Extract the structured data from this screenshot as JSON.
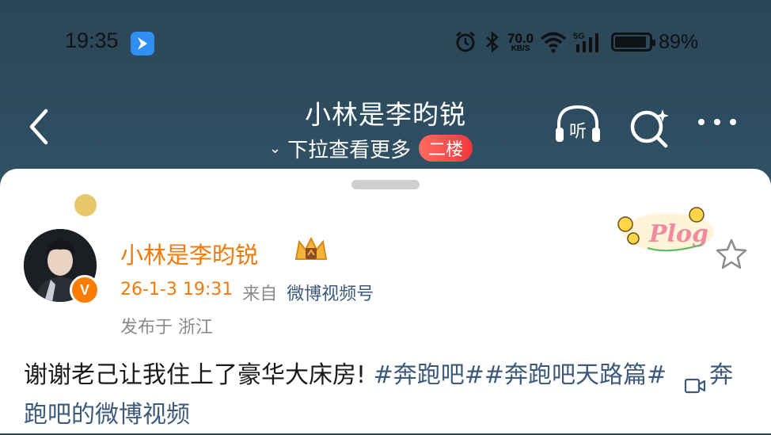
{
  "status_bar": {
    "time": "19:35",
    "net_speed_value": "70.0",
    "net_speed_unit": "KB/S",
    "signal_label": "5G",
    "battery_percent": "89%",
    "battery_level": 0.89
  },
  "nav": {
    "title": "小林是李昀锐",
    "pull_hint": "下拉查看更多",
    "floor_badge": "二楼",
    "listen_label": "听"
  },
  "post": {
    "username": "小林是李昀锐",
    "date": "26-1-3 19:31",
    "from_label": "来自",
    "source": "微博视频号",
    "location": "发布于 浙江",
    "plog_label": "Plog",
    "avatar_badge": "V",
    "text_main": "谢谢老己让我住上了豪华大床房! ",
    "tag1": "#奔跑吧#",
    "tag2": "#奔跑吧天路篇#",
    "video_link": "奔跑吧的微博视频"
  },
  "colors": {
    "accent_orange": "#f07a0c",
    "link_blue": "#3d5a7a",
    "header_bg": "#2e4d60",
    "badge_red": "#f0383f"
  }
}
